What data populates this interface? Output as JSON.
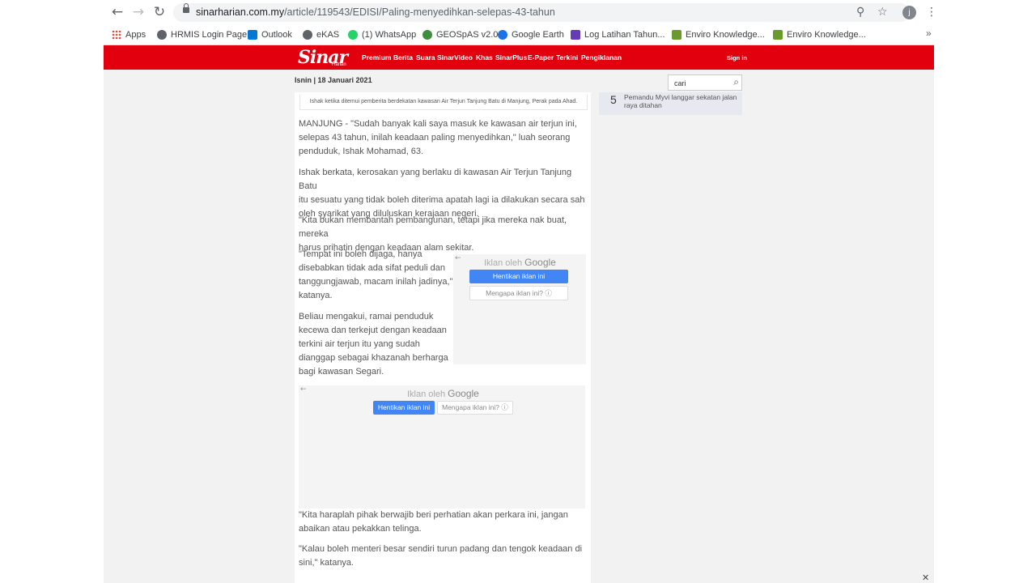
{
  "browser": {
    "url_domain": "sinarharian.com.my",
    "url_path": "/article/119543/EDISI/Paling-menyedihkan-selepas-43-tahun",
    "profile_initial": "j",
    "bookmarks": [
      {
        "label": "Apps",
        "icon": "apps-grid-icon",
        "color": "#4285f4"
      },
      {
        "label": "HRMIS Login Page",
        "icon": "globe-icon",
        "color": "#5f6368"
      },
      {
        "label": "Outlook",
        "icon": "outlook-icon",
        "color": "#0078d4"
      },
      {
        "label": "eKAS",
        "icon": "globe-icon",
        "color": "#5f6368"
      },
      {
        "label": "(1) WhatsApp",
        "icon": "whatsapp-icon",
        "color": "#25d366"
      },
      {
        "label": "GEOSpAS v2.0",
        "icon": "geospas-icon",
        "color": "#3e8e41"
      },
      {
        "label": "Google Earth",
        "icon": "google-earth-icon",
        "color": "#1a73e8"
      },
      {
        "label": "Log Latihan Tahun...",
        "icon": "forms-icon",
        "color": "#673ab7"
      },
      {
        "label": "Enviro Knowledge...",
        "icon": "enviro-icon",
        "color": "#6a9a2b"
      },
      {
        "label": "Enviro Knowledge...",
        "icon": "enviro-icon",
        "color": "#6a9a2b"
      }
    ]
  },
  "site": {
    "logo": "Sinar",
    "logo_sub": "Harian",
    "nav": [
      "Premium",
      "Berita",
      "Suara Sinar",
      "Video",
      "Khas",
      "SinarPlus",
      "E-Paper",
      "Terkini",
      "Pengiklanan"
    ],
    "signin": "Sign in",
    "date": "Isnin | 18 Januari 2021",
    "search_value": "cari",
    "brand_color": "#e2000f"
  },
  "article": {
    "caption": "Ishak ketika ditemui pemberita berdekatan kawasan Air Terjun Tanjung Batu di Manjung, Perak pada Ahad.",
    "paragraphs": [
      [
        "MANJUNG - \"Sudah banyak kali saya masuk ke kawasan air terjun ini,",
        "selepas 43 tahun, inilah keadaan paling menyedihkan,\" luah seorang",
        "penduduk, Ishak Mohamad, 63."
      ],
      [
        "Ishak berkata, kerosakan yang berlaku di kawasan Air Terjun Tanjung Batu",
        "itu sesuatu yang tidak boleh diterima apatah lagi ia dilakukan secara sah",
        "oleh syarikat yang diluluskan kerajaan negeri."
      ],
      [
        "\"Kita bukan membantah pembangunan, tetapi jika mereka nak buat, mereka",
        "harus prihatin dengan keadaan alam sekitar."
      ],
      [
        "\"Tempat ini boleh dijaga, hanya",
        "disebabkan tidak ada sifat peduli dan",
        "tanggungjawab, macam inilah jadinya,\"",
        "katanya."
      ],
      [
        "Beliau mengakui, ramai penduduk",
        "kecewa dan terkejut dengan keadaan",
        "terkini air terjun itu yang sudah",
        "dianggap sebagai khazanah berharga",
        "bagi kawasan Segari."
      ],
      [
        "\"Kita haraplah pihak berwajib beri perhatian akan perkara ini, jangan",
        "abaikan atau pekakkan telinga."
      ],
      [
        "\"Kalau boleh menteri besar sendiri turun padang dan tengok keadaan di",
        "sini,\" katanya."
      ]
    ]
  },
  "ads": {
    "by_text": "Iklan oleh",
    "by_brand": "Google",
    "stop_label": "Hentikan iklan ini",
    "why_label": "Mengapa iklan ini?",
    "info_glyph": "ⓘ"
  },
  "sidebar": {
    "number": "5",
    "headline": "Pemandu Myvi langgar sekatan jalan raya ditahan"
  }
}
